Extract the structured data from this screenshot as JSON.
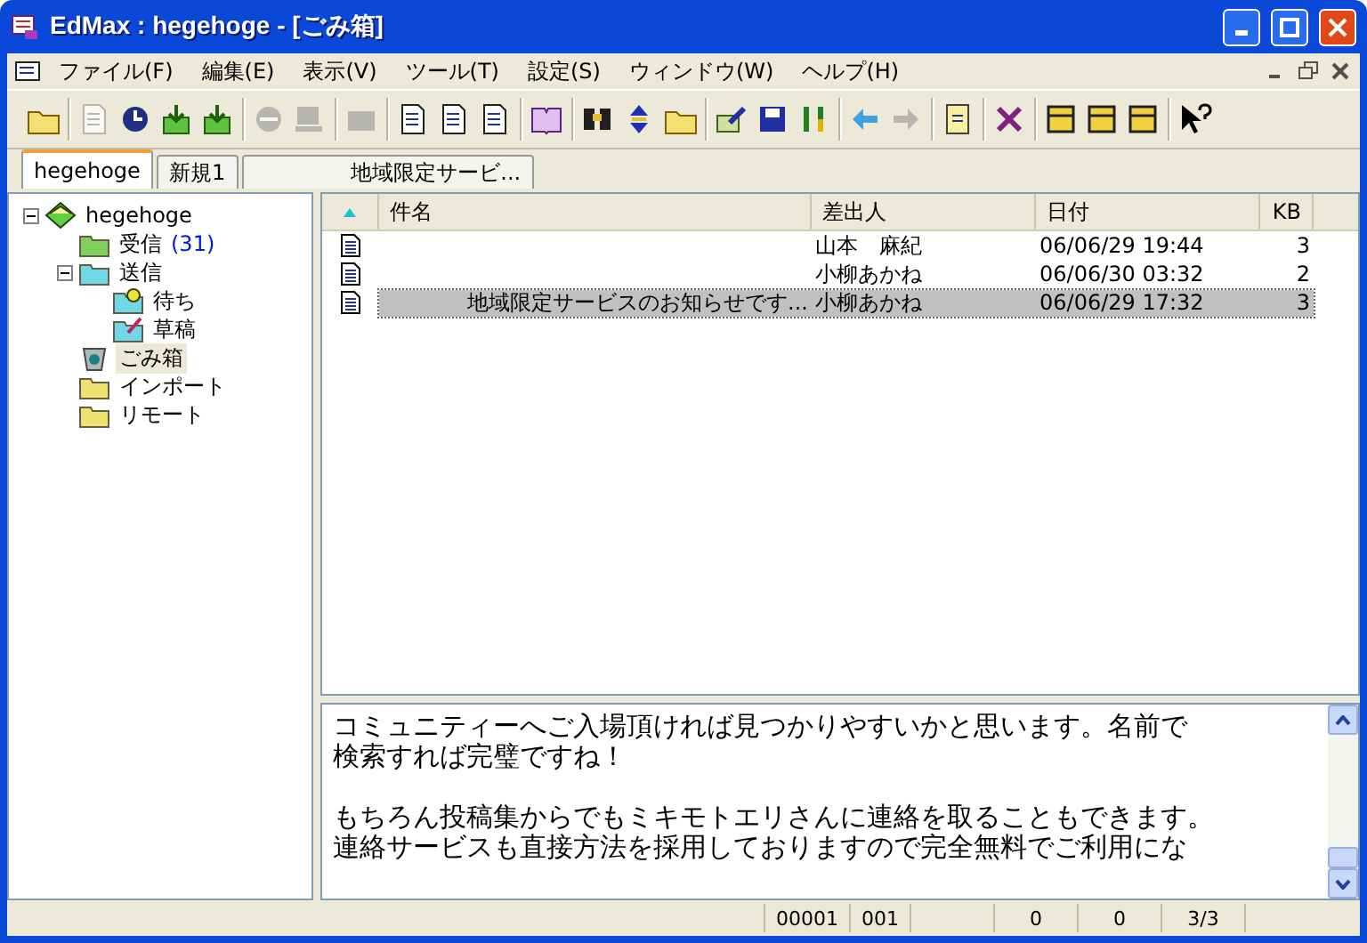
{
  "window": {
    "title": "EdMax : hegehoge - [ごみ箱]"
  },
  "menu": [
    "ファイル(F)",
    "編集(E)",
    "表示(V)",
    "ツール(T)",
    "設定(S)",
    "ウィンドウ(W)",
    "ヘルプ(H)"
  ],
  "toolbar": [
    [
      {
        "disabled": false
      }
    ],
    [
      {
        "disabled": true
      },
      {
        "disabled": false
      },
      {
        "disabled": false
      },
      {
        "disabled": false
      }
    ],
    [
      {
        "disabled": true
      },
      {
        "disabled": true
      }
    ],
    [
      {
        "disabled": true
      }
    ],
    [
      {
        "disabled": false
      },
      {
        "disabled": false
      },
      {
        "disabled": false
      }
    ],
    [
      {
        "disabled": false
      }
    ],
    [
      {
        "disabled": false
      },
      {
        "disabled": false
      },
      {
        "disabled": false
      }
    ],
    [
      {
        "disabled": false
      },
      {
        "disabled": false
      },
      {
        "disabled": false
      }
    ],
    [
      {
        "disabled": false
      },
      {
        "disabled": true
      }
    ],
    [
      {
        "disabled": false
      }
    ],
    [
      {
        "disabled": false
      }
    ],
    [
      {
        "disabled": false
      },
      {
        "disabled": false
      },
      {
        "disabled": false
      }
    ],
    [
      {
        "disabled": false
      }
    ]
  ],
  "tabs": [
    {
      "label": "hegehoge",
      "selected": true
    },
    {
      "label": "新規1",
      "selected": false
    },
    {
      "label": "地域限定サービ...",
      "selected": false
    }
  ],
  "tree": [
    {
      "kind": "account",
      "label": "hegehoge",
      "selected": false,
      "expanded": true,
      "children": [
        {
          "kind": "inbox",
          "label": "受信",
          "count": "(31)",
          "selected": false
        },
        {
          "kind": "outbox",
          "label": "送信",
          "selected": false,
          "expanded": true,
          "children": [
            {
              "kind": "queue",
              "label": "待ち",
              "selected": false
            },
            {
              "kind": "draft",
              "label": "草稿",
              "selected": false
            }
          ]
        },
        {
          "kind": "trash",
          "label": "ごみ箱",
          "selected": true
        },
        {
          "kind": "folder",
          "label": "インポート",
          "selected": false
        },
        {
          "kind": "folder",
          "label": "リモート",
          "selected": false
        }
      ]
    }
  ],
  "table": {
    "columns": [
      "件名",
      "差出人",
      "日付",
      "KB"
    ],
    "rows": [
      {
        "from": "山本　麻紀",
        "date": "06/06/29 19:44",
        "kb": "3",
        "selected": false
      },
      {
        "from": "小柳あかね",
        "date": "06/06/30 03:32",
        "kb": "2",
        "selected": false
      },
      {
        "subject": "地域限定サービスのお知らせです...",
        "from": "小柳あかね",
        "date": "06/06/29 17:32",
        "kb": "3",
        "selected": true
      }
    ]
  },
  "preview": {
    "paragraphs": [
      [
        "コミュニティーへご入場頂ければ見つかりやすいかと思います。名前で",
        "検索すれば完璧ですね！"
      ],
      [
        "もちろん投稿集からでもミキモトエリさんに連絡を取ることもできます。",
        "連絡サービスも直接方法を採用しておりますので完全無料でご利用にな"
      ]
    ]
  },
  "status_bar": [
    "00001",
    "001",
    "0",
    "0",
    "3/3"
  ]
}
